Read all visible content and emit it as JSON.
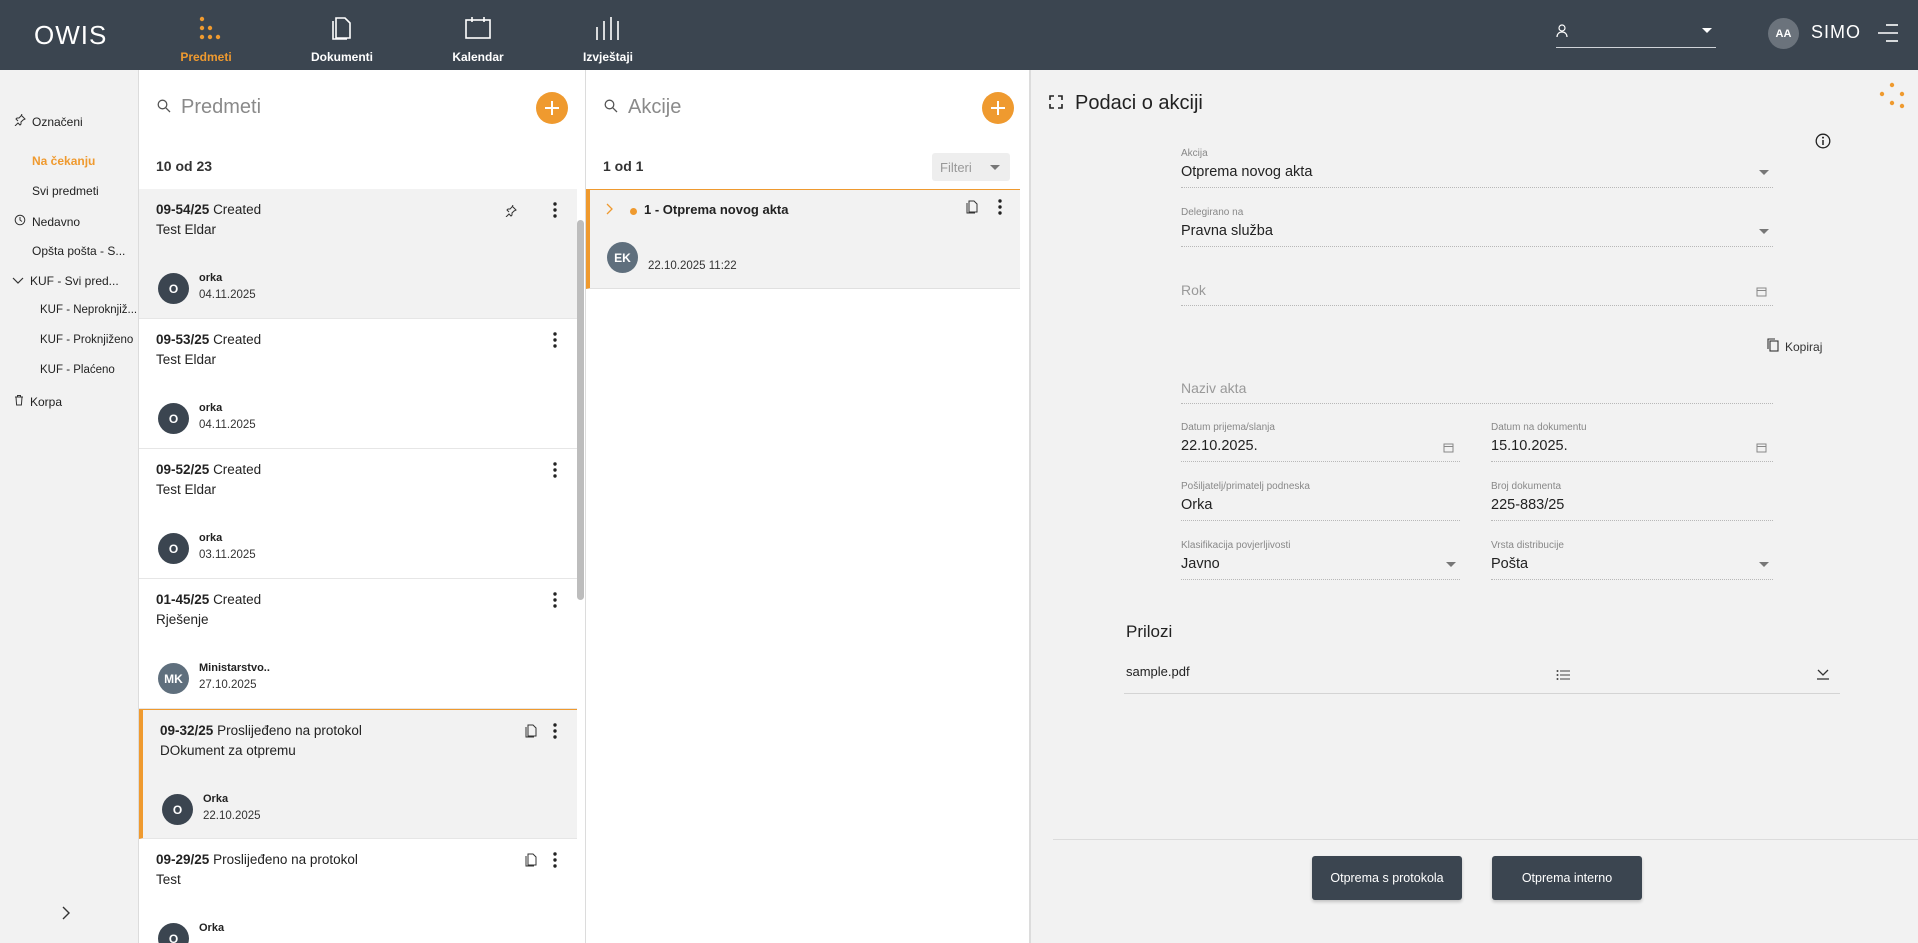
{
  "app": {
    "logo": "OWIS"
  },
  "nav": [
    {
      "label": "Predmeti",
      "icon": "dots-grid-icon",
      "active": true
    },
    {
      "label": "Dokumenti",
      "icon": "document-icon",
      "active": false
    },
    {
      "label": "Kalendar",
      "icon": "calendar-icon",
      "active": false
    },
    {
      "label": "Izvještaji",
      "icon": "bar-chart-icon",
      "active": false
    }
  ],
  "user": {
    "initials": "AA",
    "brand": "SIMO",
    "select_value": ""
  },
  "sidebar": {
    "items": [
      {
        "label": "Označeni",
        "icon": "pin-icon"
      },
      {
        "label": "Na čekanju",
        "active": true
      },
      {
        "label": "Svi predmeti"
      },
      {
        "label": "Nedavno",
        "icon": "history-icon"
      },
      {
        "label": "Opšta pošta - S..."
      },
      {
        "label": "KUF - Svi pred...",
        "icon": "chevron-down-icon"
      },
      {
        "label": "KUF - Neproknjiž..."
      },
      {
        "label": "KUF - Proknjiženo"
      },
      {
        "label": "KUF - Plaćeno"
      },
      {
        "label": "Korpa",
        "icon": "trash-icon"
      }
    ]
  },
  "predmeti": {
    "search_placeholder": "Predmeti",
    "count": "10 od 23",
    "items": [
      {
        "code": "09-54/25",
        "status": "Created",
        "subject": "Test Eldar",
        "avatar": "O",
        "person": "orka",
        "date": "04.11.2025"
      },
      {
        "code": "09-53/25",
        "status": "Created",
        "subject": "Test Eldar",
        "avatar": "O",
        "person": "orka",
        "date": "04.11.2025"
      },
      {
        "code": "09-52/25",
        "status": "Created",
        "subject": "Test Eldar",
        "avatar": "O",
        "person": "orka",
        "date": "03.11.2025"
      },
      {
        "code": "01-45/25",
        "status": "Created",
        "subject": "Rješenje",
        "avatar": "MK",
        "person": "Ministarstvo..",
        "date": "27.10.2025"
      },
      {
        "code": "09-32/25",
        "status": "Proslijeđeno na protokol",
        "subject": "DOkument za otpremu",
        "avatar": "O",
        "person": "Orka",
        "date": "22.10.2025"
      },
      {
        "code": "09-29/25",
        "status": "Proslijeđeno na protokol",
        "subject": "Test",
        "avatar": "O",
        "person": "Orka",
        "date": ""
      }
    ]
  },
  "akcije": {
    "search_placeholder": "Akcije",
    "count": "1 od 1",
    "filter_label": "Filteri",
    "items": [
      {
        "title": "1 - Otprema novog akta",
        "avatar": "EK",
        "datetime": "22.10.2025 11:22"
      }
    ]
  },
  "detail": {
    "title": "Podaci o akciji",
    "akcija": {
      "label": "Akcija",
      "value": "Otprema novog akta"
    },
    "delegirano": {
      "label": "Delegirano na",
      "value": "Pravna služba"
    },
    "rok": {
      "placeholder": "Rok"
    },
    "copy_label": "Kopiraj",
    "naziv": {
      "placeholder": "Naziv akta"
    },
    "datum_prijema": {
      "label": "Datum prijema/slanja",
      "value": "22.10.2025."
    },
    "datum_dokumenta": {
      "label": "Datum na dokumentu",
      "value": "15.10.2025."
    },
    "posiljatelj": {
      "label": "Pošiljatelj/primatelj podneska",
      "value": "Orka"
    },
    "broj": {
      "label": "Broj dokumenta",
      "value": "225-883/25"
    },
    "klasifikacija": {
      "label": "Klasifikacija povjerljivosti",
      "value": "Javno"
    },
    "distribucija": {
      "label": "Vrsta distribucije",
      "value": "Pošta"
    },
    "prilozi_title": "Prilozi",
    "attachments": [
      {
        "name": "sample.pdf"
      }
    ],
    "btn_protokol": "Otprema s protokola",
    "btn_interno": "Otprema interno"
  },
  "colors": {
    "accent": "#ef9a2f",
    "topbar": "#3b4550",
    "panel_bg": "#f2f2f2"
  }
}
